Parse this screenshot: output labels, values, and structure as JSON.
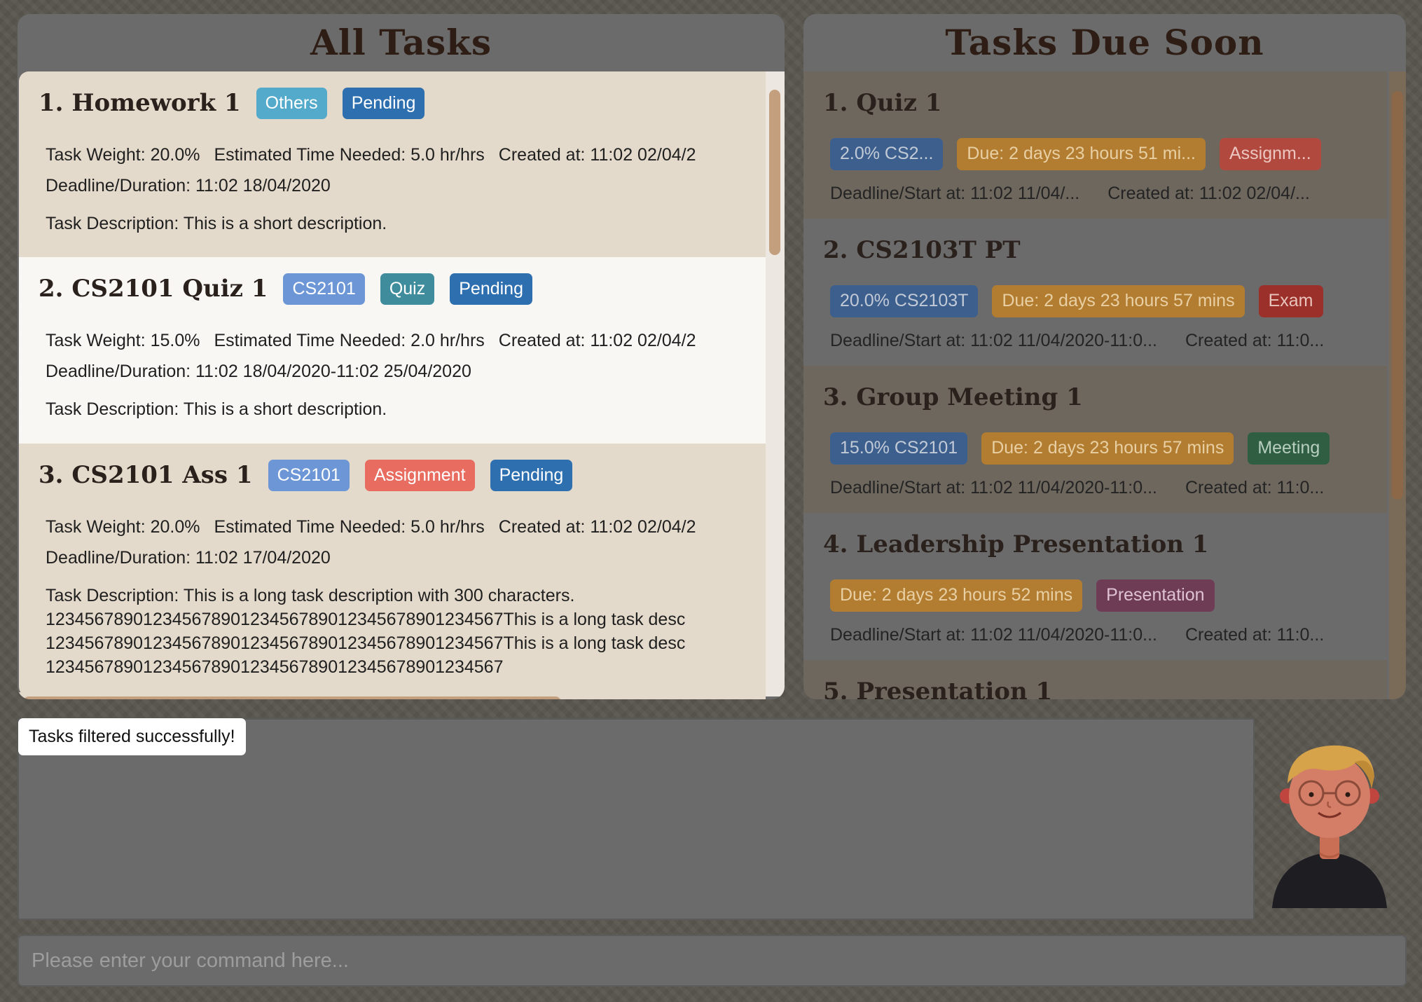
{
  "all_tasks": {
    "title": "All Tasks",
    "items": [
      {
        "title": "1.  Homework 1",
        "tags": [
          {
            "label": "Others",
            "color": "#53aacb"
          },
          {
            "label": "Pending",
            "color": "#2e6fb0"
          }
        ],
        "weight": "Task Weight: 20.0%",
        "time_needed": "Estimated Time Needed: 5.0 hr/hrs",
        "created": "Created at: 11:02 02/04/2",
        "deadline": "Deadline/Duration: 11:02 18/04/2020",
        "description_lines": [
          "Task Description: This is a short description."
        ]
      },
      {
        "title": "2.  CS2101 Quiz 1",
        "tags": [
          {
            "label": "CS2101",
            "color": "#6c96d6"
          },
          {
            "label": "Quiz",
            "color": "#3f8c9c"
          },
          {
            "label": "Pending",
            "color": "#2e6fb0"
          }
        ],
        "weight": "Task Weight: 15.0%",
        "time_needed": "Estimated Time Needed: 2.0 hr/hrs",
        "created": "Created at: 11:02 02/04/2",
        "deadline": "Deadline/Duration: 11:02 18/04/2020-11:02 25/04/2020",
        "description_lines": [
          "Task Description: This is a short description."
        ]
      },
      {
        "title": "3.  CS2101 Ass 1",
        "tags": [
          {
            "label": "CS2101",
            "color": "#6c96d6"
          },
          {
            "label": "Assignment",
            "color": "#e86c5f"
          },
          {
            "label": "Pending",
            "color": "#2e6fb0"
          }
        ],
        "weight": "Task Weight: 20.0%",
        "time_needed": "Estimated Time Needed: 5.0 hr/hrs",
        "created": "Created at: 11:02 02/04/2",
        "deadline": "Deadline/Duration: 11:02 17/04/2020",
        "description_lines": [
          "Task Description: This is a long task description with 300 characters.",
          "1234567890123456789012345678901234567890123456​7This is a long task desc",
          "1234567890123456789012345678901234567890123456​7This is a long task desc",
          "12345678901234567890123456789012345678901234567"
        ]
      }
    ]
  },
  "tasks_due_soon": {
    "title": "Tasks Due Soon",
    "items": [
      {
        "title": "1.  Quiz 1",
        "tags": [
          {
            "label": "2.0% CS2...",
            "color": "#3d5f8e"
          },
          {
            "label": "Due: 2 days 23 hours 51 mi...",
            "color": "#b27d30"
          },
          {
            "label": "Assignm...",
            "color": "#b2493e"
          }
        ],
        "deadline": "Deadline/Start at: 11:02 11/04/...",
        "created": "Created at: 11:02 02/04/..."
      },
      {
        "title": "2.  CS2103T PT",
        "tags": [
          {
            "label": "20.0% CS2103T",
            "color": "#3d5f8e"
          },
          {
            "label": "Due: 2 days 23 hours 57 mins",
            "color": "#b27d30"
          },
          {
            "label": "Exam",
            "color": "#9b2f29"
          }
        ],
        "deadline": "Deadline/Start at: 11:02 11/04/2020-11:0...",
        "created": "Created at: 11:0..."
      },
      {
        "title": "3.  Group Meeting 1",
        "tags": [
          {
            "label": "15.0% CS2101",
            "color": "#3d5f8e"
          },
          {
            "label": "Due: 2 days 23 hours 57 mins",
            "color": "#b27d30"
          },
          {
            "label": "Meeting",
            "color": "#2f5e43"
          }
        ],
        "deadline": "Deadline/Start at: 11:02 11/04/2020-11:0...",
        "created": "Created at: 11:0..."
      },
      {
        "title": "4.  Leadership Presentation 1",
        "tags": [
          {
            "label": "Due: 2 days 23 hours 52 mins",
            "color": "#b27d30"
          },
          {
            "label": "Presentation",
            "color": "#6f3c56"
          }
        ],
        "deadline": "Deadline/Start at: 11:02 11/04/2020-11:0...",
        "created": "Created at: 11:0..."
      },
      {
        "title": "5.  Presentation 1",
        "tags": [],
        "deadline": "",
        "created": ""
      }
    ]
  },
  "result_display": {
    "message": "Tasks filtered successfully!"
  },
  "command_box": {
    "placeholder": "Please enter your command here...",
    "value": ""
  },
  "icons": {
    "avatar": "cartoon-student-avatar-icon"
  }
}
